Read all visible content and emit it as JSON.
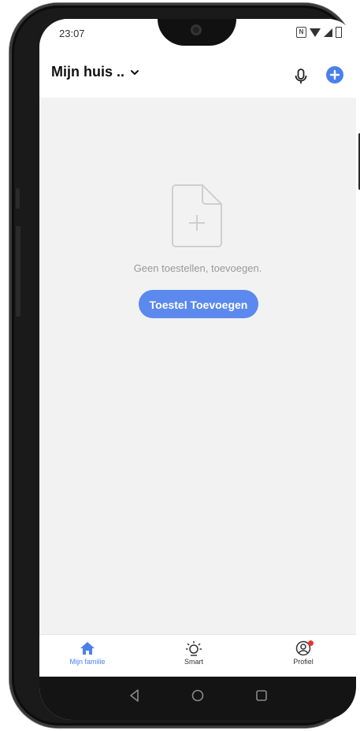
{
  "status_bar": {
    "time": "23:07",
    "icons": [
      "nfc-icon",
      "wifi-icon",
      "signal-icon",
      "battery-icon"
    ]
  },
  "header": {
    "home_name": "Mijn huis ..",
    "icons": [
      "chevron-down-icon",
      "microphone-icon",
      "plus-icon"
    ]
  },
  "empty_state": {
    "icon": "empty-document-plus-icon",
    "message": "Geen toestellen, toevoegen.",
    "button_label": "Toestel Toevoegen"
  },
  "tabs": [
    {
      "label": "Mijn familie",
      "icon": "home-icon",
      "active": true
    },
    {
      "label": "Smart",
      "icon": "sun-icon",
      "active": false
    },
    {
      "label": "Profiel",
      "icon": "profile-icon",
      "active": false,
      "badge": true
    }
  ],
  "nav_bar": {
    "icons": [
      "back-icon",
      "home-circle-icon",
      "recents-icon"
    ]
  },
  "colors": {
    "accent": "#4a80ec",
    "button": "#5b89ee",
    "background": "#f2f2f2",
    "badge": "#e8352e"
  }
}
